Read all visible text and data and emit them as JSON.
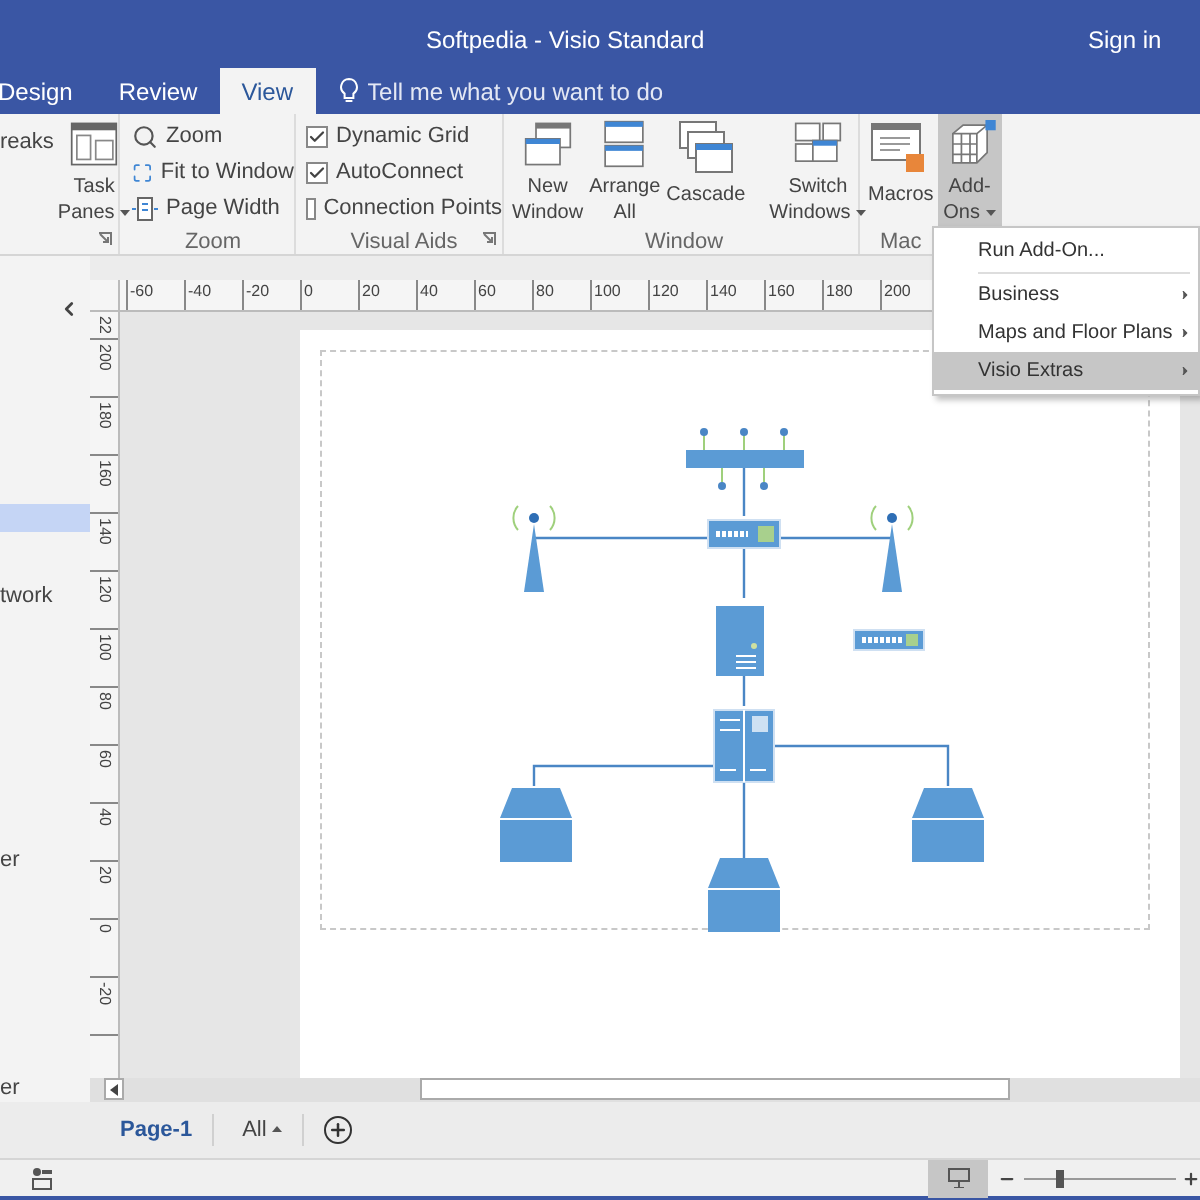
{
  "window": {
    "title": "Softpedia - Visio Standard",
    "sign_in": "Sign in"
  },
  "tabs": [
    {
      "label": "Design",
      "selected": false
    },
    {
      "label": "Review",
      "selected": false
    },
    {
      "label": "View",
      "selected": true
    }
  ],
  "tell_me": {
    "placeholder": "Tell me what you want to do"
  },
  "ribbon": {
    "groups": [
      {
        "launcher": true,
        "items": [
          {
            "kind": "text",
            "label": "reaks"
          },
          {
            "kind": "large",
            "label": "Task\nPanes",
            "dropdown": true,
            "pressed": false
          }
        ]
      },
      {
        "label": "Zoom",
        "items": [
          {
            "kind": "small",
            "label": "Zoom"
          },
          {
            "kind": "small",
            "label": "Fit to Window"
          },
          {
            "kind": "small",
            "label": "Page Width"
          }
        ]
      },
      {
        "label": "Visual Aids",
        "launcher": true,
        "items": [
          {
            "kind": "check",
            "label": "Dynamic Grid",
            "checked": true
          },
          {
            "kind": "check",
            "label": "AutoConnect",
            "checked": true
          },
          {
            "kind": "check",
            "label": "Connection Points",
            "checked": false
          }
        ]
      },
      {
        "label": "Window",
        "items": [
          {
            "kind": "large",
            "label": "New\nWindow",
            "pressed": false
          },
          {
            "kind": "large",
            "label": "Arrange\nAll",
            "pressed": false
          },
          {
            "kind": "large",
            "label": "Cascade",
            "pressed": false
          },
          {
            "kind": "separator"
          },
          {
            "kind": "large",
            "label": "Switch\nWindows",
            "dropdown": true,
            "pressed": false
          }
        ]
      },
      {
        "label": "Mac",
        "items": [
          {
            "kind": "large",
            "label": "Macros",
            "pressed": false
          },
          {
            "kind": "large",
            "label": "Add-\nOns",
            "dropdown": true,
            "pressed": true
          }
        ]
      }
    ]
  },
  "addons_menu": {
    "items": [
      {
        "label": "Run Add-On...",
        "submenu": false,
        "selected": false
      },
      {
        "label": "Business",
        "submenu": true,
        "selected": false
      },
      {
        "label": "Maps and Floor Plans",
        "submenu": true,
        "selected": false
      },
      {
        "label": "Visio Extras",
        "submenu": true,
        "selected": true
      }
    ]
  },
  "shapes_pane": {
    "items": [
      {
        "selected": true
      },
      {
        "label": "twork",
        "selected": false
      },
      {
        "label": "er",
        "selected": false
      },
      {
        "label": "er",
        "selected": false
      }
    ]
  },
  "ruler_h": [
    "-60",
    "-40",
    "-20",
    "0",
    "20",
    "40",
    "60",
    "80",
    "100",
    "120",
    "140",
    "160",
    "180",
    "200"
  ],
  "ruler_v": [
    "22",
    "200",
    "180",
    "160",
    "140",
    "120",
    "100",
    "80",
    "60",
    "40",
    "20",
    "0",
    "-20"
  ],
  "page_tabs": [
    {
      "label": "Page-1",
      "kind": "page",
      "selected": true
    },
    {
      "label": "All",
      "kind": "all",
      "selected": false
    }
  ],
  "status_bar": {
    "zoom": {
      "level": 0.22
    }
  }
}
